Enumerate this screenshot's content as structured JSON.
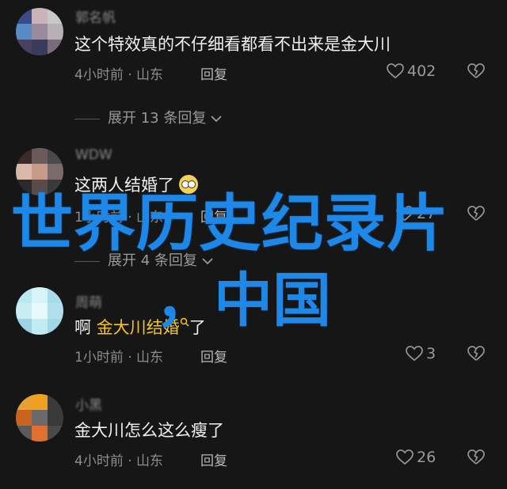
{
  "comments": [
    {
      "username": "郭名帆",
      "text": "这个特效真的不仔细看都看不出来是金大川",
      "time": "4小时前",
      "location": "山东",
      "reply": "回复",
      "likes": "402",
      "avatar_colors": [
        "#3a4a8c",
        "#c9b4b8",
        "#c8c8c8",
        "#5a8ac6",
        "#9a8a9c",
        "#b8b0b4",
        "#4a4060",
        "#3a3a5a",
        "#7a6a7a"
      ]
    },
    {
      "username": "WDW",
      "text": "这两人结婚了",
      "time": "1小时前",
      "location": "山东",
      "reply": "回复",
      "likes": "27",
      "avatar_colors": [
        "#3c2a2a",
        "#6a5a5a",
        "#4a4a4a",
        "#d8b8a8",
        "#c89a88",
        "#7a6a6a",
        "#2a2a2a",
        "#5a4a4a",
        "#3a3a3a"
      ]
    },
    {
      "username": "周萌",
      "text_prefix": "啊 ",
      "mention": "金大川",
      "text_suffix": "了",
      "time": "1小时前",
      "location": "山东",
      "reply": "回复",
      "likes": "3",
      "avatar_colors": [
        "#b8e8f0",
        "#d8f4f8",
        "#a8dce8",
        "#c8eef4",
        "#e8f8fa",
        "#b0e0ec",
        "#9cd4e4",
        "#c0ecf2",
        "#a0d8e6"
      ]
    },
    {
      "username": "小黑",
      "text": "金大川怎么这么瘦了",
      "time": "4小时前",
      "location": "山东",
      "reply": "回复",
      "likes": "26",
      "avatar_colors": [
        "#e8a030",
        "#f0a020",
        "#3a3a3a",
        "#c86420",
        "#6a6a6a",
        "#3a3a3a",
        "#5a5a5a",
        "#e07030",
        "#4a4a4a"
      ]
    }
  ],
  "expand_1": "展开 13 条回复",
  "expand_2": "展开 4 条回复",
  "overlay": {
    "title": "世界历史纪录片",
    "subtitle": "，中国"
  },
  "mention_partial": "结婚"
}
